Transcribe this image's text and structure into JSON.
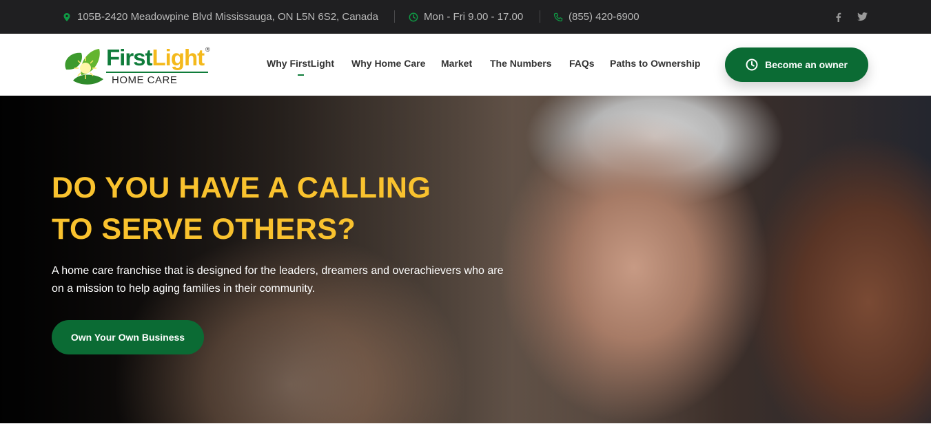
{
  "topbar": {
    "address": "105B-2420 Meadowpine Blvd Mississauga, ON L5N 6S2, Canada",
    "hours": "Mon - Fri 9.00 - 17.00",
    "phone": "(855) 420-6900",
    "social": [
      {
        "icon": "facebook-icon",
        "glyph": "f"
      },
      {
        "icon": "twitter-icon",
        "glyph": "t"
      }
    ]
  },
  "logo": {
    "first": "First",
    "light": "Light",
    "registered": "®",
    "sub": "HOME CARE"
  },
  "nav": {
    "items": [
      {
        "label": "Why FirstLight",
        "active": true
      },
      {
        "label": "Why Home Care"
      },
      {
        "label": "Market"
      },
      {
        "label": "The Numbers"
      },
      {
        "label": "FAQs"
      },
      {
        "label": "Paths to Ownership"
      }
    ],
    "cta_label": "Become an owner"
  },
  "hero": {
    "title_line1": "DO YOU HAVE A CALLING",
    "title_line2": "TO SERVE OTHERS?",
    "desc_line1": "A home care franchise that is designed for the leaders, dreamers and overachievers who are",
    "desc_line2": "on a mission to help aging families in their community.",
    "button_label": "Own Your Own Business"
  },
  "colors": {
    "brand_green": "#0b6b34",
    "accent_yellow": "#f9c22e",
    "topbar_bg": "#1f1f21"
  }
}
